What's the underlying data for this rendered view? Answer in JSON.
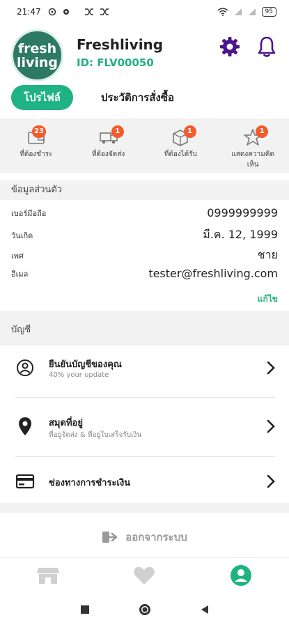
{
  "status_bar": {
    "time": "21:47",
    "battery": "95",
    "icons_left": [
      "location-icon",
      "settings-icon",
      "shuffle-icon",
      "shuffle-icon"
    ],
    "icons_right": [
      "wifi-icon",
      "signal-icon",
      "signal-icon",
      "battery-icon"
    ]
  },
  "header": {
    "logo_line1": "fresh",
    "logo_line2": "living",
    "shop_name": "Freshliving",
    "shop_id": "ID: FLV00050",
    "accent_color": "#22b07d",
    "icon_color": "#4a148c"
  },
  "tabs": {
    "profile": "โปรไฟล์",
    "history": "ประวัติการสั่งซื้อ"
  },
  "orders": [
    {
      "label": "ที่ต้องชำระ",
      "badge": "23",
      "icon": "wallet-icon"
    },
    {
      "label": "ที่ต้องจัดส่ง",
      "badge": "1",
      "icon": "truck-icon"
    },
    {
      "label": "ที่ต้องได้รับ",
      "badge": "1",
      "icon": "box-icon"
    },
    {
      "label": "แสดงความคิดเห็น",
      "badge": "1",
      "icon": "star-icon"
    }
  ],
  "personal": {
    "heading": "ข้อมูลส่วนตัว",
    "phone_label": "เบอร์มือถือ",
    "phone_value": "0999999999",
    "birthday_label": "วันเกิด",
    "birthday_value": "มี.ค. 12, 1999",
    "gender_label": "เพศ",
    "gender_value": "ชาย",
    "email_label": "อีเมล",
    "email_value": "tester@freshliving.com",
    "edit_label": "แก้ไข"
  },
  "account": {
    "heading": "บัญชี",
    "items": [
      {
        "title": "ยืนยันบัญชีของคุณ",
        "subtitle": "40% your update",
        "icon": "user-circle-icon"
      },
      {
        "title": "สมุดที่อยู่",
        "subtitle": "ที่อยู่จัดส่ง & ที่อยู่ใบเสร็จรับเงิน",
        "icon": "location-pin-icon"
      },
      {
        "title": "ช่องทางการชำระเงิน",
        "subtitle": "",
        "icon": "credit-card-icon"
      }
    ]
  },
  "logout_label": "ออกจากระบบ",
  "bottom_nav": [
    "store-icon",
    "heart-icon",
    "profile-icon"
  ]
}
